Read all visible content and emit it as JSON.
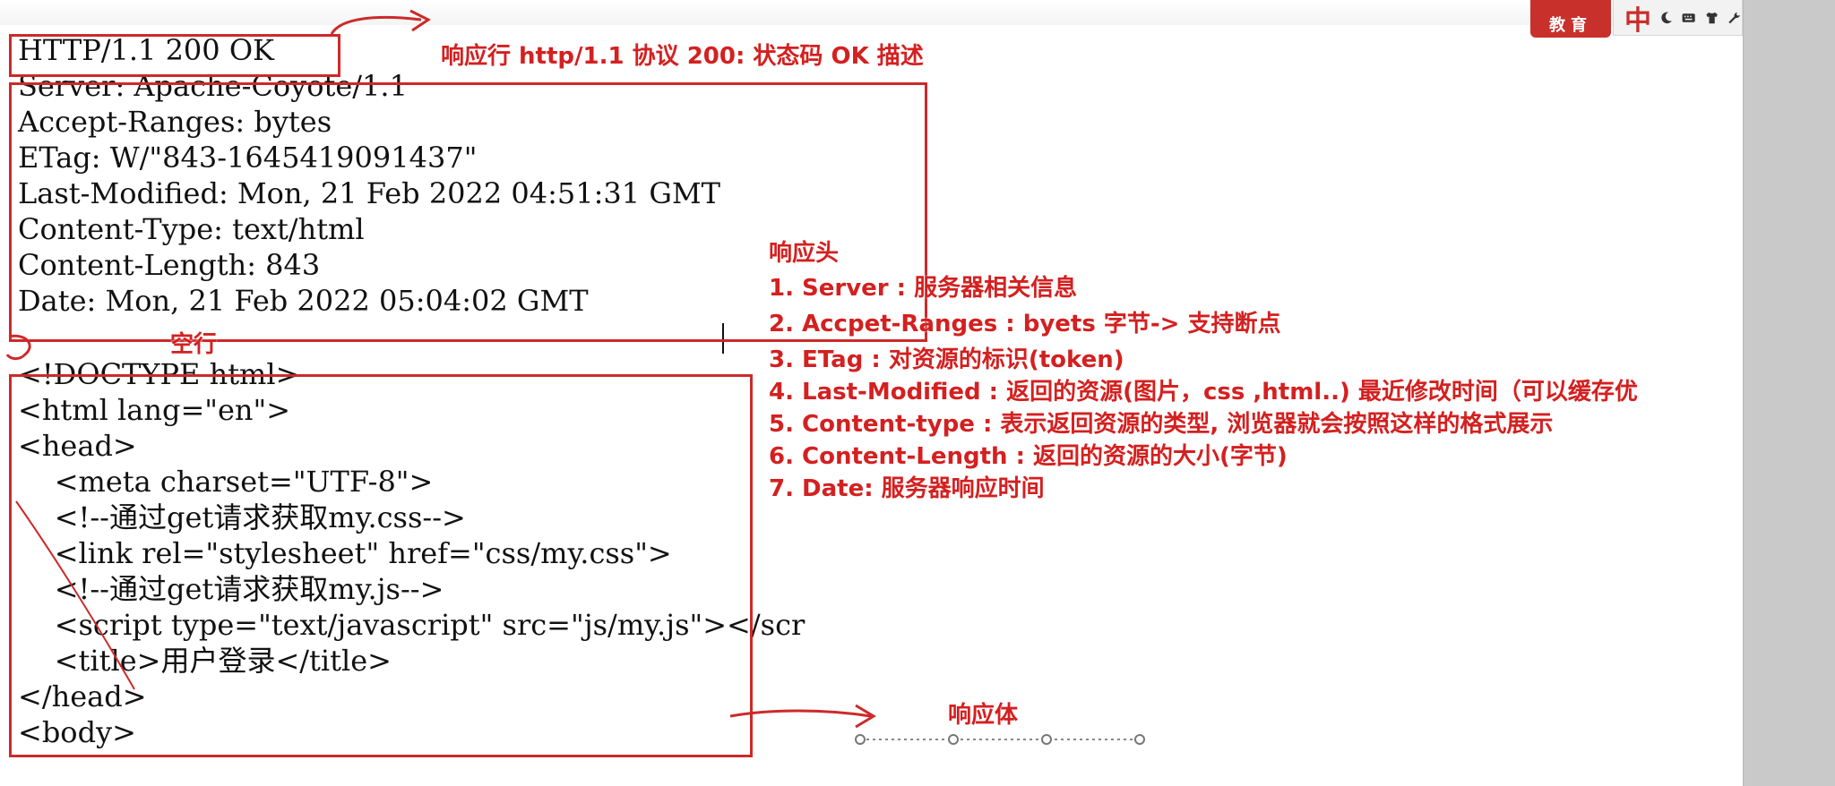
{
  "http_response": {
    "status_line": "HTTP/1.1 200 OK",
    "headers": [
      "Server: Apache-Coyote/1.1",
      "Accept-Ranges: bytes",
      "ETag: W/\"843-1645419091437\"",
      "Last-Modified: Mon, 21 Feb 2022 04:51:31 GMT",
      "Content-Type: text/html",
      "Content-Length: 843",
      "Date: Mon, 21 Feb 2022 05:04:02 GMT"
    ],
    "body": [
      "<!DOCTYPE html>",
      "<html lang=\"en\">",
      "<head>",
      "    <meta charset=\"UTF-8\">",
      "    <!--通过get请求获取my.css-->",
      "    <link rel=\"stylesheet\" href=\"css/my.css\">",
      "    <!--通过get请求获取my.js-->",
      "    <script type=\"text/javascript\" src=\"js/my.js\"></scr",
      "    <title>用户登录</title>",
      "</head>",
      "<body>"
    ]
  },
  "annotations": {
    "status_line_note": "响应行 http/1.1 协议 200: 状态码 OK 描述",
    "headers_title": "响应头",
    "header_notes": [
      "1. Server : 服务器相关信息",
      "2. Accpet-Ranges : byets 字节-> 支持断点",
      "3. ETag : 对资源的标识(token)",
      "4. Last-Modified : 返回的资源(图片，css ,html..) 最近修改时间（可以缓存优",
      "5. Content-type :  表示返回资源的类型, 浏览器就会按照这样的格式展示",
      "6. Content-Length : 返回的资源的大小(字节)",
      "7. Date: 服务器响应时间"
    ],
    "blank_line_note": "空行",
    "body_note": "响应体"
  },
  "overlay": {
    "brand_text": "教育",
    "ime_mode": "中",
    "ime_icons": [
      "moon-icon",
      "keyboard-icon",
      "shirt-icon",
      "wrench-icon"
    ]
  },
  "colors": {
    "annotation_red": "#d42020",
    "box_red": "#cc2a2a",
    "code_text": "#111111",
    "scrollbar": "#c9c9c9"
  }
}
